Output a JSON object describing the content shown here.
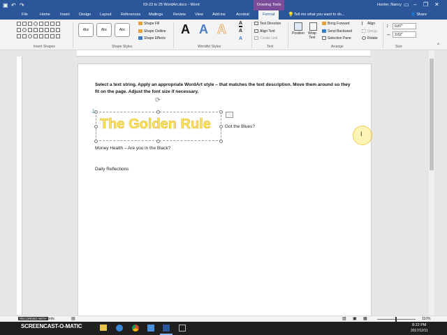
{
  "titlebar": {
    "doc_title": "03-23 to 25 WordArt.docx - Word",
    "context_tab": "Drawing Tools",
    "user": "Hunter, Nancy"
  },
  "tabs": [
    "File",
    "Home",
    "Insert",
    "Design",
    "Layout",
    "References",
    "Mailings",
    "Review",
    "View",
    "Add-ins",
    "Acrobat",
    "Format"
  ],
  "active_tab": "Format",
  "tell_me": "Tell me what you want to do...",
  "share_label": "Share",
  "ribbon": {
    "insert_shapes_label": "Insert Shapes",
    "shape_styles_label": "Shape Styles",
    "style_box_label": "Abc",
    "shape_fill": "Shape Fill",
    "shape_outline": "Shape Outline",
    "shape_effects": "Shape Effects",
    "wordart_label": "WordArt Styles",
    "wordart_glyph": "A",
    "text_label": "Text",
    "text_direction": "Text Direction",
    "align_text": "Align Text",
    "create_link": "Create Link",
    "position": "Position",
    "wrap_text": "Wrap Text",
    "bring_forward": "Bring Forward",
    "send_backward": "Send Backward",
    "selection_pane": "Selection Pane",
    "align": "Align",
    "group": "Group",
    "rotate": "Rotate",
    "arrange_label": "Arrange",
    "height_value": "0.87\"",
    "width_value": "3.62\"",
    "size_label": "Size"
  },
  "document": {
    "instructions": "Select a text string. Apply an appropriate WordArt style – that matches the text description. Move them around so they fit on the page. Adjust the font size if necessary.",
    "wordart_text": "The Golden Rule",
    "line1": "Got the Blues?",
    "line2": "Money Health – Are you in the Black?",
    "line3": "Daily Reflections"
  },
  "statusbar": {
    "words": "PAGE 1 OF 1   40 words",
    "zoom": "110%"
  },
  "taskbar": {
    "time": "8:22 PM",
    "date": "2017/12/11",
    "watermark": "RECORDED WITH",
    "watermark_brand": "SCREENCAST-O-MATIC"
  },
  "colors": {
    "accent": "#2b579a",
    "wordart_fill": "#f7e36a",
    "wordart_outline": "#e5b821"
  }
}
